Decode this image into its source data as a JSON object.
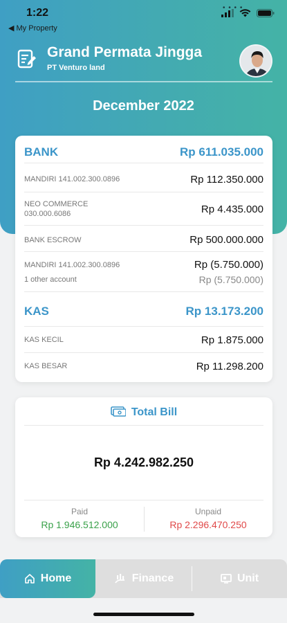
{
  "status": {
    "time": "1:22",
    "back_label": "◀ My Property"
  },
  "header": {
    "property_name": "Grand Permata Jingga",
    "company": "PT Venturo land"
  },
  "period": "December 2022",
  "bank": {
    "title": "BANK",
    "total": "Rp 611.035.000",
    "accounts": [
      {
        "name": "MANDIRI 141.002.300.0896",
        "amount": "Rp 112.350.000"
      },
      {
        "name": "NEO COMMERCE",
        "name2": "030.000.6086",
        "amount": "Rp 4.435.000"
      },
      {
        "name": "BANK ESCROW",
        "amount": "Rp 500.000.000"
      },
      {
        "name": "MANDIRI 141.002.300.0896",
        "amount": "Rp (5.750.000)",
        "sub_name": "1 other account",
        "sub_amount": "Rp (5.750.000)"
      }
    ]
  },
  "kas": {
    "title": "KAS",
    "total": "Rp 13.173.200",
    "accounts": [
      {
        "name": "KAS KECIL",
        "amount": "Rp 1.875.000"
      },
      {
        "name": "KAS BESAR",
        "amount": "Rp 11.298.200"
      }
    ]
  },
  "bill": {
    "title": "Total Bill",
    "total": "Rp 4.242.982.250",
    "paid_label": "Paid",
    "paid": "Rp 1.946.512.000",
    "unpaid_label": "Unpaid",
    "unpaid": "Rp 2.296.470.250",
    "paid_color": "#3aa14a",
    "unpaid_color": "#e04848"
  },
  "tabs": {
    "home": "Home",
    "finance": "Finance",
    "unit": "Unit"
  },
  "icons": [
    "document-edit-icon",
    "wifi-icon",
    "battery-icon",
    "bill-icon",
    "home-icon",
    "finance-icon",
    "unit-icon"
  ]
}
